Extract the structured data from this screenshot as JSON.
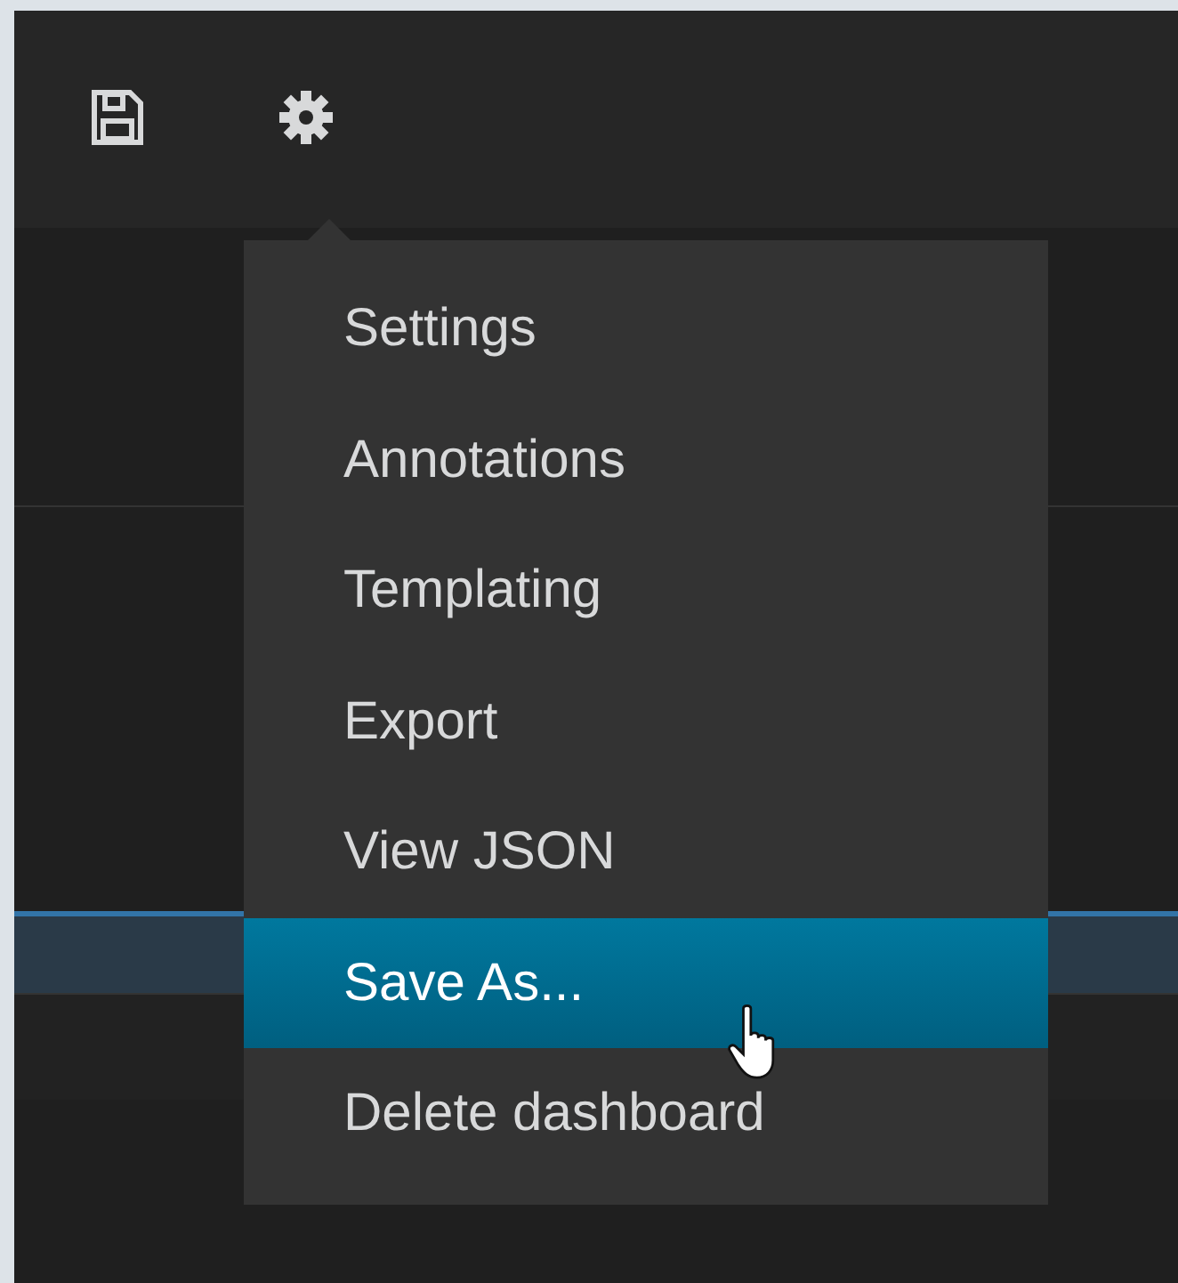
{
  "toolbar": {
    "buttons": [
      {
        "kind": "save"
      },
      {
        "kind": "settings"
      }
    ]
  },
  "menu": {
    "items": [
      {
        "label": "Settings",
        "selected": false
      },
      {
        "label": "Annotations",
        "selected": false
      },
      {
        "label": "Templating",
        "selected": false
      },
      {
        "label": "Export",
        "selected": false
      },
      {
        "label": "View JSON",
        "selected": false
      },
      {
        "label": "Save As...",
        "selected": true
      },
      {
        "label": "Delete dashboard",
        "selected": false
      }
    ]
  }
}
